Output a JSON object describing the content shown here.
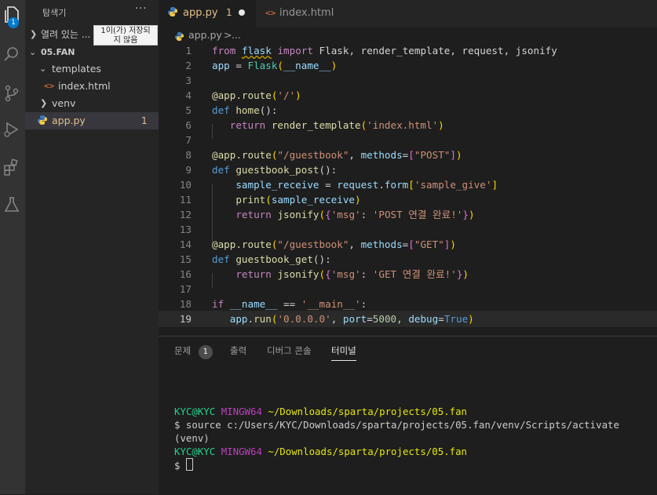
{
  "sidebar": {
    "title": "탐색기",
    "more": "···",
    "open_editors": "열려 있는 ...",
    "tooltip_line1": "1이(가) 저장되",
    "tooltip_line2": "지 않음",
    "folder": "05.FAN",
    "templates": "templates",
    "index_file": "index.html",
    "venv": "venv",
    "app_file": "app.py",
    "app_problems": "1"
  },
  "activity": {
    "badge": "1"
  },
  "tabs": [
    {
      "label": "app.py",
      "problems": "1",
      "modified": true
    },
    {
      "label": "index.html"
    }
  ],
  "breadcrumb": {
    "file": "app.py",
    "sep": ">",
    "rest": "..."
  },
  "code": {
    "line_numbers": [
      "1",
      "2",
      "3",
      "4",
      "5",
      "6",
      "7",
      "8",
      "9",
      "10",
      "11",
      "12",
      "13",
      "14",
      "15",
      "16",
      "17",
      "18",
      "19"
    ],
    "l1": {
      "a": "from",
      "b": "flask",
      "c": "import",
      "d": "Flask, render_template, request, jsonify"
    },
    "l2": {
      "a": "app",
      "b": " = ",
      "c": "Flask",
      "d": "(",
      "e": "__name__",
      "f": ")"
    },
    "l4": {
      "a": "@app.route",
      "b": "(",
      "c": "'/'",
      "d": ")"
    },
    "l5": {
      "a": "def",
      "b": "home",
      "c": "():"
    },
    "l6": {
      "a": "return",
      "b": "render_template",
      "c": "(",
      "d": "'index.html'",
      "e": ")"
    },
    "l8": {
      "a": "@app.route",
      "b": "(",
      "c": "\"/guestbook\"",
      "d": ", ",
      "e": "methods",
      "f": "=",
      "g": "[",
      "h": "\"POST\"",
      "i": "]",
      "j": ")"
    },
    "l9": {
      "a": "def",
      "b": "guestbook_post",
      "c": "():"
    },
    "l10": {
      "a": "sample_receive",
      "b": " = ",
      "c": "request",
      "d": ".",
      "e": "form",
      "f": "[",
      "g": "'sample_give'",
      "h": "]"
    },
    "l11": {
      "a": "print",
      "b": "(",
      "c": "sample_receive",
      "d": ")"
    },
    "l12": {
      "a": "return",
      "b": "jsonify",
      "c": "(",
      "d": "{",
      "e": "'msg'",
      "f": ": ",
      "g": "'POST 연결 완료!'",
      "h": "}",
      "i": ")"
    },
    "l14": {
      "a": "@app.route",
      "b": "(",
      "c": "\"/guestbook\"",
      "d": ", ",
      "e": "methods",
      "f": "=",
      "g": "[",
      "h": "\"GET\"",
      "i": "]",
      "j": ")"
    },
    "l15": {
      "a": "def",
      "b": "guestbook_get",
      "c": "():"
    },
    "l16": {
      "a": "return",
      "b": "jsonify",
      "c": "(",
      "d": "{",
      "e": "'msg'",
      "f": ": ",
      "g": "'GET 연결 완료!'",
      "h": "}",
      "i": ")"
    },
    "l18": {
      "a": "if",
      "b": "__name__",
      "c": " == ",
      "d": "'__main__'",
      "e": ":"
    },
    "l19": {
      "a": "app",
      "b": ".",
      "c": "run",
      "d": "(",
      "e": "'0.0.0.0'",
      "f": ", ",
      "g": "port",
      "h": "=",
      "i": "5000",
      "j": ", ",
      "k": "debug",
      "l": "=",
      "m": "True",
      "n": ")"
    }
  },
  "panel": {
    "tabs": [
      "문제",
      "출력",
      "디버그 콘솔",
      "터미널"
    ],
    "problems_count": "1",
    "terminal": {
      "p1_user": "KYC@KYC",
      "p1_shell": "MINGW64",
      "p1_path": "~/Downloads/sparta/projects/05.fan",
      "cmd": "$ source c:/Users/KYC/Downloads/sparta/projects/05.fan/venv/Scripts/activate",
      "venv": "(venv)",
      "p2_user": "KYC@KYC",
      "p2_shell": "MINGW64",
      "p2_path": "~/Downloads/sparta/projects/05.fan",
      "prompt": "$"
    }
  }
}
